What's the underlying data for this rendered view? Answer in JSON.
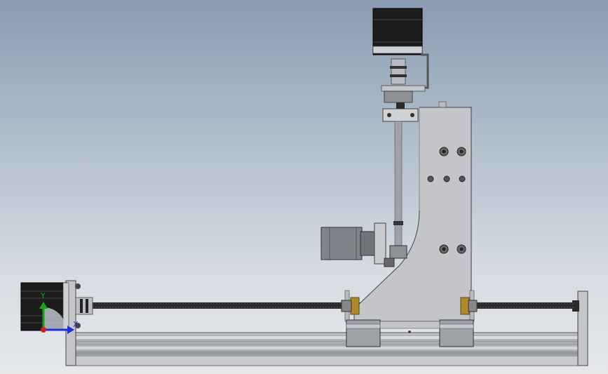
{
  "viewport": {
    "background_top": "#8a9bb0",
    "background_bottom": "#e6e8ea"
  },
  "triad": {
    "y_label": "Y",
    "x_label": "X",
    "y_color": "#1aa31a",
    "x_color": "#2030d0",
    "z_color": "#d02020"
  },
  "colors": {
    "aluminum": "#c9cbcf",
    "aluminum_dark": "#8c8f95",
    "motor_black": "#1c1c1c",
    "leadscrew": "#2a2a2a",
    "brass": "#b08a2a",
    "steel": "#9aa0a8",
    "motor_grey": "#80838a"
  }
}
